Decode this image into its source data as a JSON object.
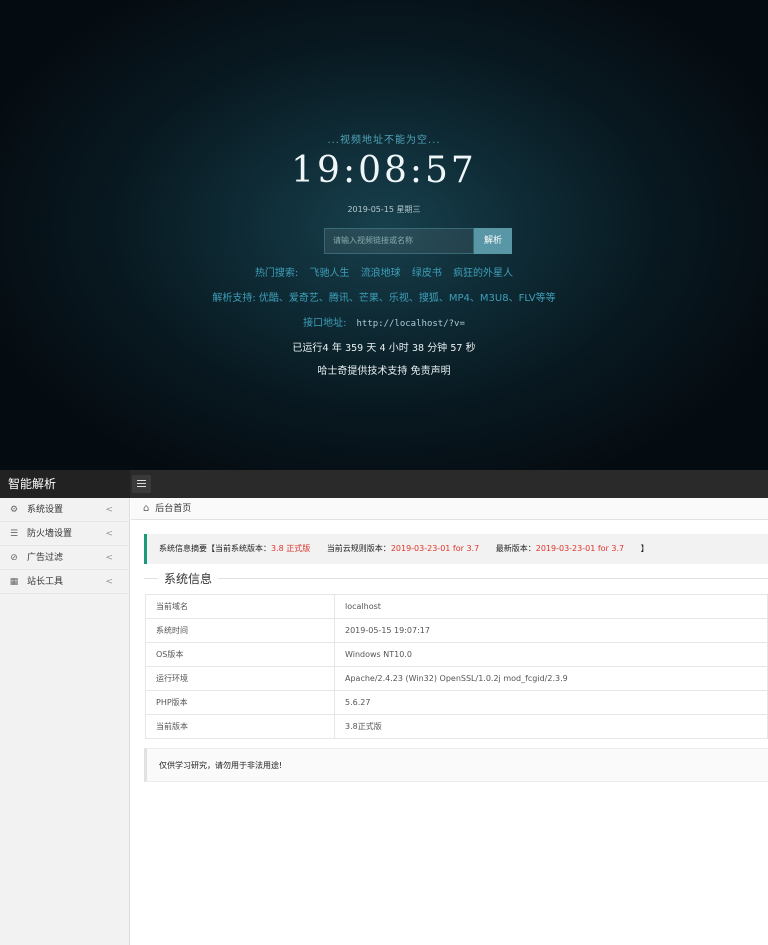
{
  "hero": {
    "tip": "...视频地址不能为空...",
    "clock": "19:08:57",
    "date": "2019-05-15  星期三",
    "search": {
      "placeholder": "请输入视频链接或名称",
      "button": "解析"
    },
    "hot": {
      "label": "热门搜索:",
      "items": [
        "飞驰人生",
        "流浪地球",
        "绿皮书",
        "疯狂的外星人"
      ]
    },
    "support": "解析支持: 优酷、爱奇艺、腾讯、芒果、乐视、搜狐、MP4、M3U8、FLV等等",
    "api": {
      "label": "接口地址:",
      "url": "http://localhost/?v="
    },
    "runtime": {
      "prefix": "已运行4 年",
      "days": "359",
      "days_unit": "天",
      "hours": "4",
      "hours_unit": "小时",
      "minutes": "38",
      "minutes_unit": "分钟",
      "seconds": "57",
      "seconds_unit": "秒"
    },
    "credit": "哈士奇提供技术支持 免责声明"
  },
  "admin": {
    "brand": "智能解析",
    "sidebar": [
      {
        "icon": "gear-icon",
        "glyph": "⚙",
        "label": "系统设置"
      },
      {
        "icon": "list-icon",
        "glyph": "☰",
        "label": "防火墙设置"
      },
      {
        "icon": "filter-icon",
        "glyph": "⊘",
        "label": "广告过滤"
      },
      {
        "icon": "grid-icon",
        "glyph": "▦",
        "label": "站长工具"
      }
    ],
    "chevron": "<",
    "breadcrumb": "后台首页",
    "notice": {
      "title": "系统信息摘要【当前系统版本：",
      "version": "3.8 正式版",
      "rule_label": "当前云规则版本：",
      "rule_version": "2019-03-23-01 for 3.7",
      "latest_label": "最新版本：",
      "latest_version": "2019-03-23-01 for 3.7",
      "close": "】"
    },
    "sysinfo": {
      "legend": "系统信息",
      "rows": [
        {
          "key": "当前域名",
          "value": "localhost"
        },
        {
          "key": "系统时间",
          "value": "2019-05-15 19:07:17"
        },
        {
          "key": "OS版本",
          "value": "Windows NT10.0"
        },
        {
          "key": "运行环境",
          "value": "Apache/2.4.23 (Win32) OpenSSL/1.0.2j mod_fcgid/2.3.9"
        },
        {
          "key": "PHP版本",
          "value": "5.6.27"
        },
        {
          "key": "当前版本",
          "value": "3.8正式版"
        }
      ]
    },
    "footer_note": "仅供学习研究，请勿用于非法用途!"
  },
  "colors": {
    "accent_teal": "#3e9fb9",
    "notice_border": "#1a9a7a",
    "version_red": "#e0342a",
    "topbar": "#2a2a2a"
  }
}
